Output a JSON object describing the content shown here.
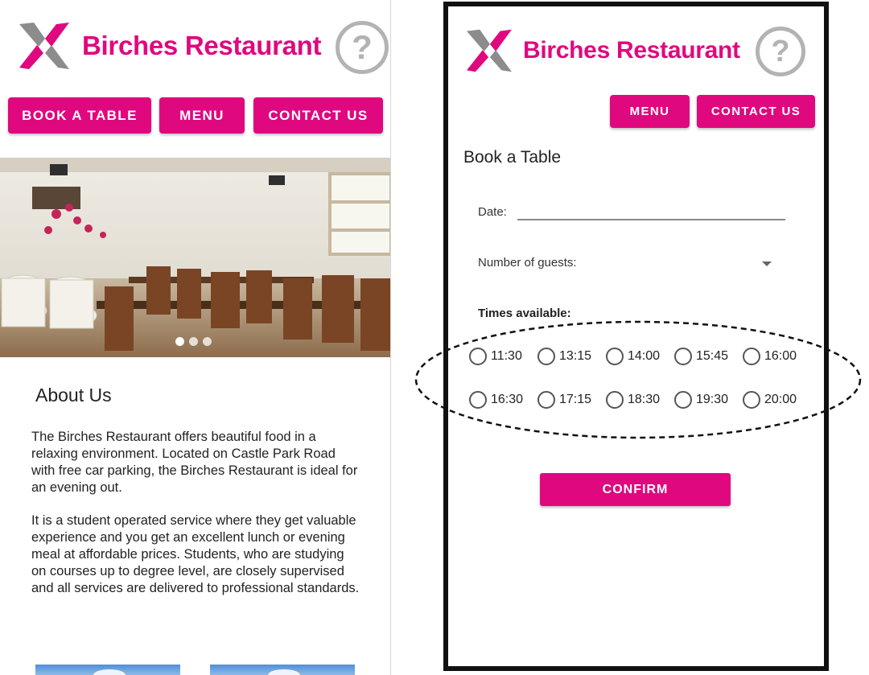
{
  "brand": {
    "name": "Birches Restaurant",
    "accent_color": "#e0087f",
    "logo_icon": "x-logo-icon",
    "help_icon": "help-icon",
    "help_glyph": "?"
  },
  "left_screen": {
    "nav": {
      "book": "BOOK A TABLE",
      "menu": "MENU",
      "contact": "CONTACT US"
    },
    "carousel": {
      "slide_count": 3,
      "active_index": 0
    },
    "about": {
      "title": "About Us",
      "paragraph1": "The Birches Restaurant offers beautiful food in a relaxing environment. Located on Castle Park Road with free car parking, the Birches Restaurant is ideal for an evening out.",
      "paragraph2": "It is a student operated service where they get valuable experience and you get an excellent lunch or evening meal at affordable prices. Students, who are studying on courses up to degree level, are closely supervised and all services are delivered to professional standards."
    }
  },
  "right_screen": {
    "nav": {
      "menu": "MENU",
      "contact": "CONTACT US"
    },
    "form": {
      "title": "Book a Table",
      "date_label": "Date:",
      "date_value": "",
      "guests_label": "Number of guests:",
      "guests_value": "",
      "times_label": "Times available:",
      "times_row1": [
        "11:30",
        "13:15",
        "14:00",
        "15:45",
        "16:00"
      ],
      "times_row2": [
        "16:30",
        "17:15",
        "18:30",
        "19:30",
        "20:00"
      ],
      "confirm": "CONFIRM"
    }
  }
}
